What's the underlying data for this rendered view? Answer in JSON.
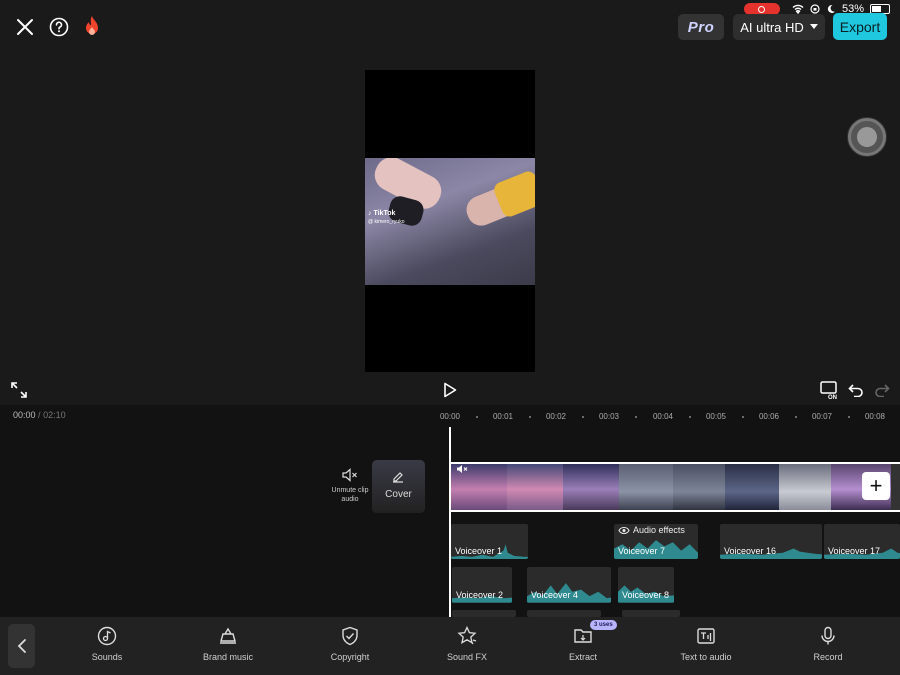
{
  "status_bar": {
    "battery": "53%"
  },
  "toolbar": {
    "pro_label": "Pro",
    "quality_label": "AI ultra HD",
    "export_label": "Export"
  },
  "preview": {
    "watermark_brand": "TikTok",
    "watermark_user": "@ kimero_ryuko"
  },
  "timeline": {
    "current_time": "00:00",
    "separator": "/",
    "total_time": "02:10",
    "ticks": [
      "00:00",
      "00:01",
      "00:02",
      "00:03",
      "00:04",
      "00:05",
      "00:06",
      "00:07",
      "00:08"
    ],
    "unmute_label": "Unmute clip audio",
    "cover_label": "Cover",
    "audio_effects_label": "Audio effects",
    "voiceovers": [
      {
        "label": "Voiceover 1"
      },
      {
        "label": "Voiceover 7"
      },
      {
        "label": "Voiceover 16"
      },
      {
        "label": "Voiceover 17"
      },
      {
        "label": "Voiceover 2"
      },
      {
        "label": "Voiceover 4"
      },
      {
        "label": "Voiceover 8"
      }
    ]
  },
  "tools": [
    {
      "label": "Sounds",
      "icon": "music-note-icon"
    },
    {
      "label": "Brand music",
      "icon": "brand-music-icon"
    },
    {
      "label": "Copyright",
      "icon": "shield-check-icon"
    },
    {
      "label": "Sound FX",
      "icon": "sound-fx-icon"
    },
    {
      "label": "Extract",
      "icon": "folder-icon",
      "badge": "3 uses"
    },
    {
      "label": "Text to audio",
      "icon": "text-to-audio-icon"
    },
    {
      "label": "Record",
      "icon": "microphone-icon"
    }
  ],
  "colors": {
    "accent": "#1fc8de",
    "recording": "#e5322d",
    "waveform": "#2e8a8f"
  }
}
